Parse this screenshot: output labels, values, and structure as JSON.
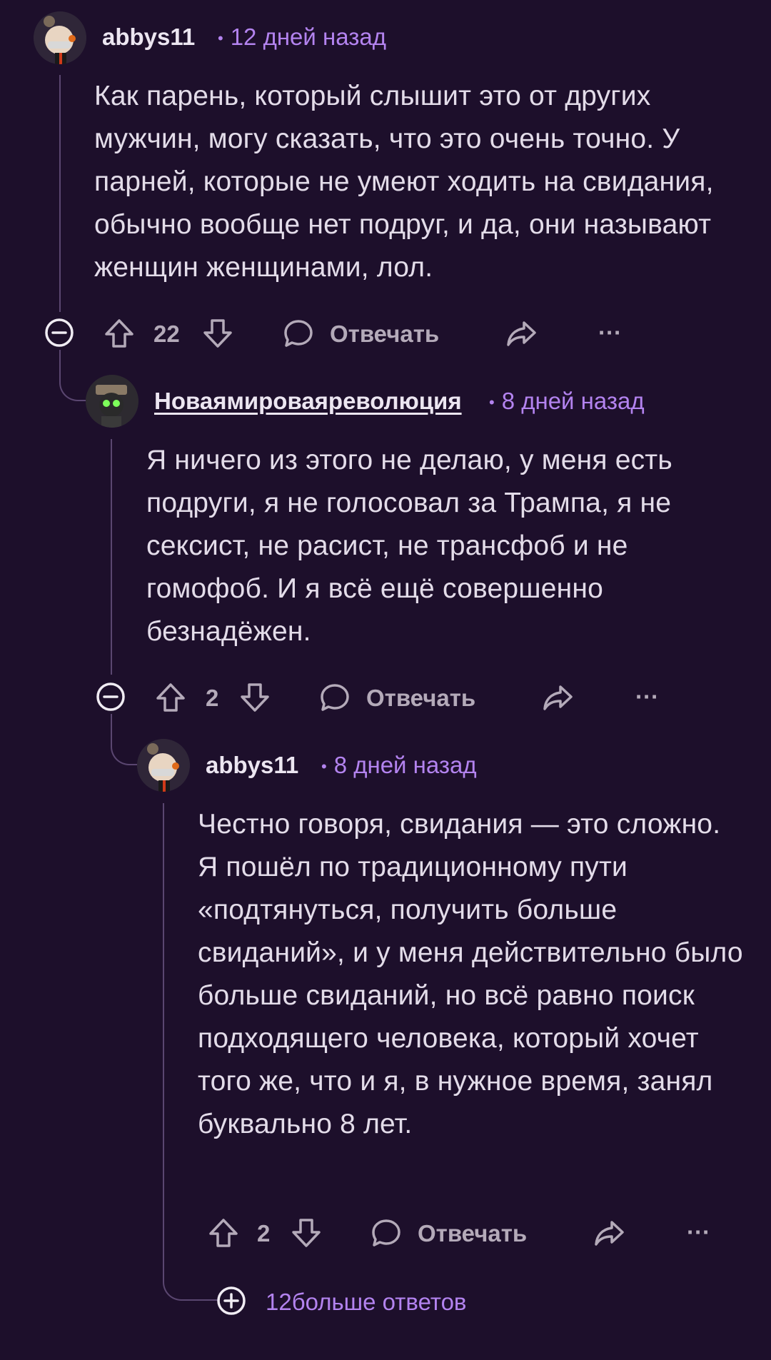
{
  "comments": [
    {
      "username": "abbys11",
      "time": "12 дней назад",
      "text": "Как парень, который слышит это от других мужчин, могу сказать, что это очень точно. У парней, которые не умеют ходить на свидания, обычно вообще нет подруг, и да, они называют женщин женщинами, лол.",
      "votes": "22",
      "reply_label": "Отвечать",
      "more_label": "···"
    },
    {
      "username": "Новаямироваяреволюция",
      "time": "8 дней назад",
      "text": "Я ничего из этого не делаю, у меня есть подруги, я не голосовал за Трампа, я не сексист, не расист, не трансфоб и не гомофоб. И я всё ещё совершенно безнадёжен.",
      "votes": "2",
      "reply_label": "Отвечать",
      "more_label": "···"
    },
    {
      "username": "abbys11",
      "time": "8 дней назад",
      "text": "Честно говоря, свидания — это сложно. Я пошёл по традиционному пути «подтянуться, получить больше свиданий», и у меня действительно было больше свиданий, но всё равно поиск подходящего человека, который хочет того же, что и я, в нужное время, занял буквально 8 лет.",
      "votes": "2",
      "reply_label": "Отвечать",
      "more_label": "···"
    }
  ],
  "more_replies": "12больше ответов",
  "colors": {
    "background": "#1d0f2b",
    "thread_line": "#5a4670",
    "meta": "#b383ef",
    "action": "#b4aab9"
  },
  "icons": [
    "collapse-icon",
    "upvote-icon",
    "downvote-icon",
    "reply-icon",
    "share-icon",
    "more-icon",
    "expand-icon"
  ]
}
